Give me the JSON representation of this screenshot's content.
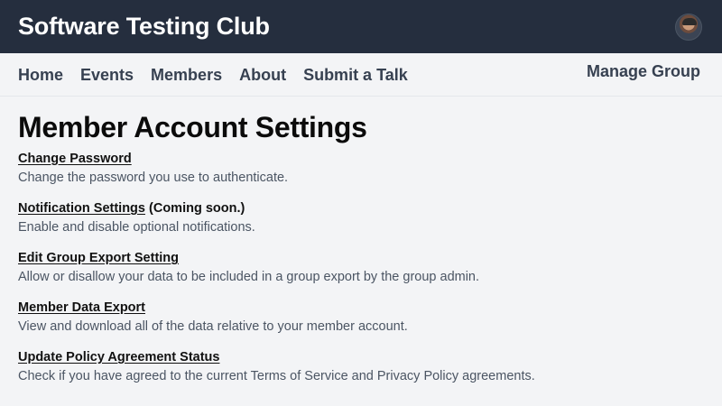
{
  "header": {
    "site_title": "Software Testing Club",
    "avatar_icon": "user-avatar"
  },
  "nav": {
    "links": [
      "Home",
      "Events",
      "Members",
      "About",
      "Submit a Talk"
    ],
    "manage_group": "Manage Group"
  },
  "main": {
    "title": "Member Account Settings",
    "settings": [
      {
        "title": "Change Password",
        "note": "",
        "description": "Change the password you use to authenticate."
      },
      {
        "title": "Notification Settings",
        "note": "(Coming soon.)",
        "description": "Enable and disable optional notifications."
      },
      {
        "title": "Edit Group Export Setting",
        "note": "",
        "description": "Allow or disallow your data to be included in a group export by the group admin."
      },
      {
        "title": "Member Data Export",
        "note": "",
        "description": "View and download all of the data relative to your member account."
      },
      {
        "title": "Update Policy Agreement Status",
        "note": "",
        "description": "Check if you have agreed to the current Terms of Service and Privacy Policy agreements."
      }
    ]
  },
  "colors": {
    "header_bg": "#252e3e",
    "page_bg": "#f3f4f6",
    "nav_text": "#374151"
  }
}
